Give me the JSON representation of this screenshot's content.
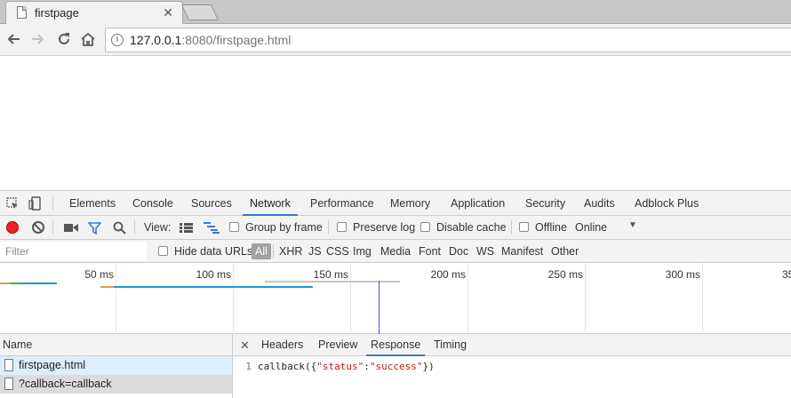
{
  "browser": {
    "tab_title": "firstpage",
    "url_host": "127.0.0.1",
    "url_rest": ":8080/firstpage.html"
  },
  "devtools": {
    "tabs": [
      "Elements",
      "Console",
      "Sources",
      "Network",
      "Performance",
      "Memory",
      "Application",
      "Security",
      "Audits",
      "Adblock Plus"
    ],
    "active_tab": "Network",
    "toolbar": {
      "view_label": "View:",
      "group_by_frame": "Group by frame",
      "preserve_log": "Preserve log",
      "disable_cache": "Disable cache",
      "offline": "Offline",
      "throttle": "Online"
    },
    "filter": {
      "placeholder": "Filter",
      "hide_data_urls": "Hide data URLs",
      "all": "All",
      "types": [
        "XHR",
        "JS",
        "CSS",
        "Img",
        "Media",
        "Font",
        "Doc",
        "WS",
        "Manifest",
        "Other"
      ]
    },
    "overview": {
      "ticks": [
        "50 ms",
        "100 ms",
        "150 ms",
        "200 ms",
        "250 ms",
        "300 ms",
        "35"
      ]
    },
    "requests": {
      "header": "Name",
      "rows": [
        "firstpage.html",
        "?callback=callback"
      ]
    },
    "detail": {
      "tabs": [
        "Headers",
        "Preview",
        "Response",
        "Timing"
      ],
      "active_tab": "Response",
      "line_number": "1",
      "code_prefix": "callback({",
      "key": "\"status\"",
      "colon": ":",
      "value": "\"success\"",
      "code_suffix": "})"
    },
    "colors": {
      "accent": "#3879d9",
      "record": "#e22222",
      "string": "#c41a16"
    }
  }
}
